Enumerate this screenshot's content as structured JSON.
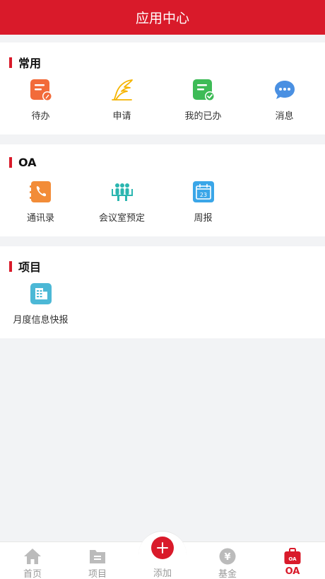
{
  "header": {
    "title": "应用中心"
  },
  "sections": [
    {
      "title": "常用",
      "items": [
        {
          "label": "待办",
          "icon": "todo-icon",
          "color": "#f26b3a"
        },
        {
          "label": "申请",
          "icon": "feather-pen-icon",
          "color": "#f5b400"
        },
        {
          "label": "我的已办",
          "icon": "done-list-icon",
          "color": "#3dbb56"
        },
        {
          "label": "消息",
          "icon": "chat-bubble-icon",
          "color": "#4a90e2"
        }
      ]
    },
    {
      "title": "OA",
      "items": [
        {
          "label": "通讯录",
          "icon": "phone-book-icon",
          "color": "#f28c38"
        },
        {
          "label": "会议室预定",
          "icon": "meeting-room-icon",
          "color": "#2bb6b0"
        },
        {
          "label": "周报",
          "icon": "calendar-icon",
          "color": "#3aa6e8"
        }
      ]
    },
    {
      "title": "项目",
      "items": [
        {
          "label": "月度信息快报",
          "icon": "building-report-icon",
          "color": "#4cb8d6"
        }
      ]
    }
  ],
  "calendar_day": "23",
  "tabbar": {
    "home": "首页",
    "project": "项目",
    "add": "添加",
    "fund": "基金",
    "oa": "OA",
    "fund_symbol": "¥",
    "oa_badge": "OA"
  },
  "colors": {
    "brand": "#d91a2a",
    "inactive": "#999999"
  }
}
